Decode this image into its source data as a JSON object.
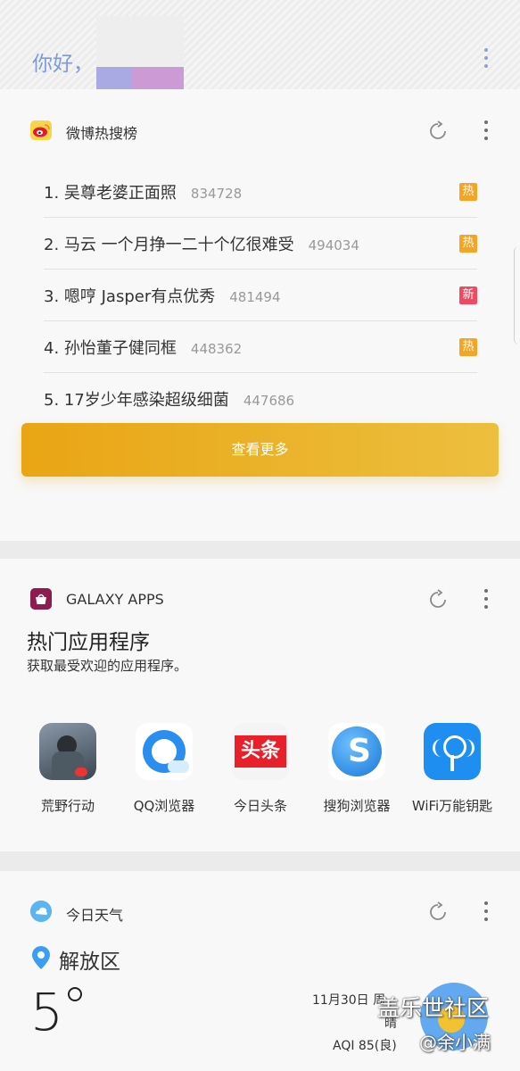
{
  "header": {
    "greeting": "你好，"
  },
  "weibo": {
    "title": "微博热搜榜",
    "items": [
      {
        "text": "1. 吴尊老婆正面照",
        "count": "834728",
        "badge": "热",
        "badge_color": "#f5a524"
      },
      {
        "text": "2. 马云 一个月挣一二十个亿很难受",
        "count": "494034",
        "badge": "热",
        "badge_color": "#f5a524"
      },
      {
        "text": "3. 嗯哼 Jasper有点优秀",
        "count": "481494",
        "badge": "新",
        "badge_color": "#ef4a62"
      },
      {
        "text": "4. 孙怡董子健同框",
        "count": "448362",
        "badge": "热",
        "badge_color": "#f5a524"
      },
      {
        "text": "5. 17岁少年感染超级细菌",
        "count": "447686",
        "badge": "",
        "badge_color": ""
      }
    ],
    "more_label": "查看更多"
  },
  "galaxy_apps": {
    "title": "GALAXY APPS",
    "heading": "热门应用程序",
    "subheading": "获取最受欢迎的应用程序。",
    "apps": [
      {
        "name": "荒野行动",
        "icon": "knives-out-game-icon"
      },
      {
        "name": "QQ浏览器",
        "icon": "qq-browser-icon"
      },
      {
        "name": "今日头条",
        "icon": "toutiao-icon",
        "icon_text": "头条"
      },
      {
        "name": "搜狗浏览器",
        "icon": "sogou-browser-icon"
      },
      {
        "name": "WiFi万能钥匙",
        "icon": "wifi-master-key-icon"
      }
    ]
  },
  "weather": {
    "title": "今日天气",
    "location": "解放区",
    "temperature": "5",
    "date": "11月30日 周",
    "condition": "晴",
    "aqi": "AQI 85(良)"
  },
  "watermark": {
    "line1": "盖乐世社区",
    "line2": "@余小满"
  }
}
